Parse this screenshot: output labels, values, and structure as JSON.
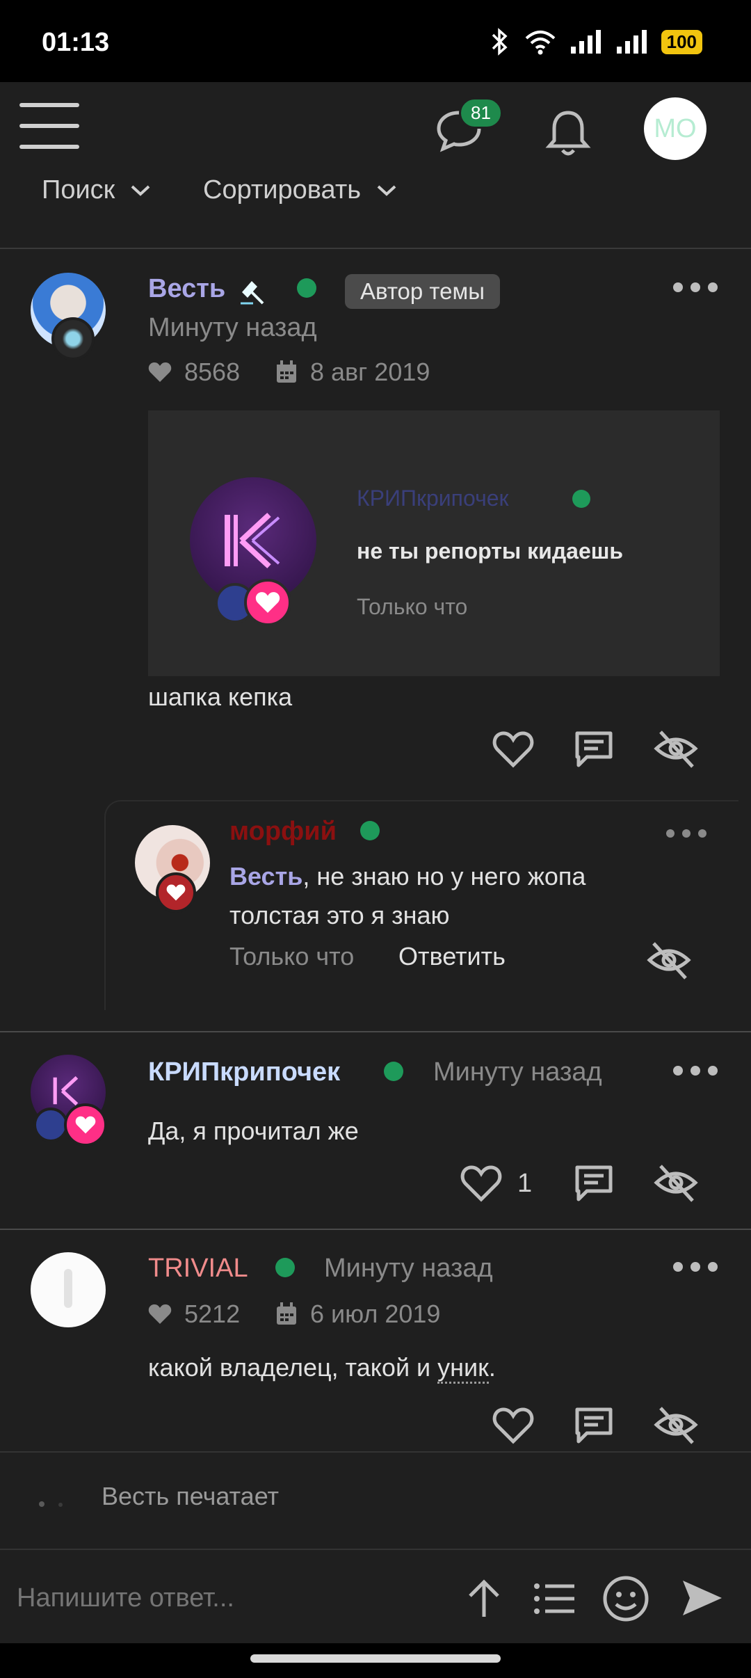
{
  "status_bar": {
    "time": "01:13",
    "battery": "100"
  },
  "header": {
    "chat_badge": "81",
    "avatar_initials": "МО",
    "search_label": "Поиск",
    "sort_label": "Сортировать"
  },
  "posts": [
    {
      "author": "Весть",
      "badge": "Автор темы",
      "time": "Минуту назад",
      "likes": "8568",
      "joined": "8 авг 2019",
      "quote": {
        "author": "КРИПкрипочек",
        "text": "не ты репорты кидаешь",
        "time": "Только что"
      },
      "text": "шапка кепка",
      "reply": {
        "author": "морфий",
        "mention": "Весть",
        "text": ", не знаю но у него жопа",
        "text2": "толстая это я знаю",
        "time": "Только что",
        "reply_label": "Ответить"
      }
    },
    {
      "author": "КРИПкрипочек",
      "time": "Минуту назад",
      "text": "Да, я прочитал же",
      "like_count": "1"
    },
    {
      "author": "TRIVIAL",
      "time": "Минуту назад",
      "likes": "5212",
      "joined": "6 июл 2019",
      "text_before": "какой владелец, такой и ",
      "text_link": "уник",
      "text_after": "."
    }
  ],
  "typing": {
    "text": "Весть печатает"
  },
  "composer": {
    "placeholder": "Напишите ответ..."
  },
  "colors": {
    "author_vest": "#a9a6e6",
    "author_krip": "#c9dbff",
    "author_morfiy": "#8b1010",
    "author_trivial": "#f08b8b",
    "online": "#1e9a5a"
  }
}
